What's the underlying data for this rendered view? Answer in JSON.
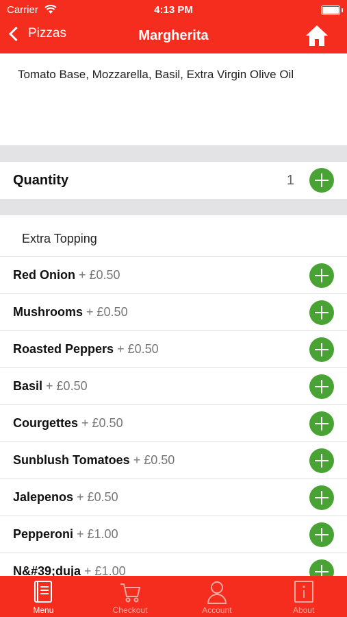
{
  "status_bar": {
    "carrier": "Carrier",
    "time": "4:13 PM"
  },
  "nav": {
    "back_label": "Pizzas",
    "title": "Margherita",
    "home_icon": "home-icon"
  },
  "description": "Tomato Base, Mozzarella, Basil, Extra Virgin Olive Oil",
  "quantity": {
    "label": "Quantity",
    "value": "1"
  },
  "extras": {
    "heading": "Extra Topping",
    "items": [
      {
        "name": "Red Onion",
        "price": " + £0.50"
      },
      {
        "name": "Mushrooms",
        "price": " + £0.50"
      },
      {
        "name": "Roasted Peppers",
        "price": " + £0.50"
      },
      {
        "name": "Basil",
        "price": " + £0.50"
      },
      {
        "name": "Courgettes",
        "price": " + £0.50"
      },
      {
        "name": "Sunblush Tomatoes",
        "price": " + £0.50"
      },
      {
        "name": "Jalepenos",
        "price": " + £0.50"
      },
      {
        "name": "Pepperoni",
        "price": " + £1.00"
      },
      {
        "name": "N&#39;duja",
        "price": " + £1.00"
      }
    ]
  },
  "tabs": [
    {
      "label": "Menu",
      "icon": "menu-book-icon",
      "active": true
    },
    {
      "label": "Checkout",
      "icon": "cart-icon",
      "active": false
    },
    {
      "label": "Account",
      "icon": "person-icon",
      "active": false
    },
    {
      "label": "About",
      "icon": "info-icon",
      "active": false
    }
  ],
  "colors": {
    "brand": "#f52d1e",
    "add_button": "#48a334",
    "separator": "#e3e3e5"
  }
}
